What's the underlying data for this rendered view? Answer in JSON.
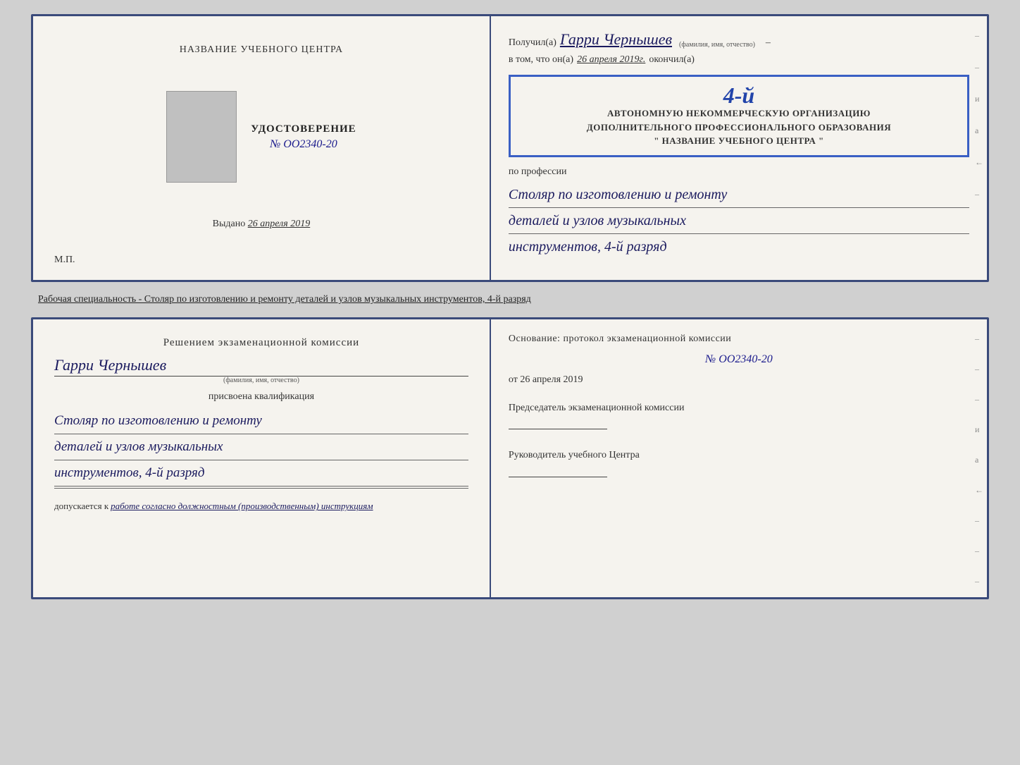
{
  "page": {
    "background": "#d0d0d0"
  },
  "top_cert": {
    "left": {
      "org_name": "НАЗВАНИЕ УЧЕБНОГО ЦЕНТРА",
      "udostoverenie_title": "УДОСТОВЕРЕНИЕ",
      "number_label": "№",
      "number": "OO2340-20",
      "vydano_label": "Выдано",
      "vydano_date": "26 апреля 2019",
      "mp_label": "М.П."
    },
    "right": {
      "poluchil_label": "Получил(а)",
      "name": "Гарри Чернышев",
      "name_hint": "(фамилия, имя, отчество)",
      "vtom_label": "в том, что он(а)",
      "date_value": "26 апреля 2019г.",
      "okonchil_label": "окончил(а)",
      "stamp_line1": "АВТОНОМНУЮ НЕКОММЕРЧЕСКУЮ ОРГАНИЗАЦИЮ",
      "stamp_line2": "ДОПОЛНИТЕЛЬНОГО ПРОФЕССИОНАЛЬНОГО ОБРАЗОВАНИЯ",
      "stamp_line3": "\" НАЗВАНИЕ УЧЕБНОГО ЦЕНТРА \"",
      "stamp_year": "4-й",
      "po_professii_label": "по профессии",
      "profession_line1": "Столяр по изготовлению и ремонту",
      "profession_line2": "деталей и узлов музыкальных",
      "profession_line3": "инструментов, 4-й разряд",
      "side_marks": [
        "–",
        "и",
        "а",
        "←",
        "–"
      ]
    }
  },
  "caption": {
    "text": "Рабочая специальность - Столяр по изготовлению и ремонту деталей и узлов музыкальных инструментов, 4-й разряд"
  },
  "bottom_cert": {
    "left": {
      "resheniem_label": "Решением экзаменационной комиссии",
      "name": "Гарри Чернышев",
      "name_hint": "(фамилия, имя, отчество)",
      "prisvoena_label": "присвоена квалификация",
      "qualification_line1": "Столяр по изготовлению и ремонту",
      "qualification_line2": "деталей и узлов музыкальных",
      "qualification_line3": "инструментов, 4-й разряд",
      "dopuskaetsya_label": "допускается к",
      "dopuskaetsya_value": "работе согласно должностным (производственным) инструкциям"
    },
    "right": {
      "osnovaniye_label": "Основание: протокол экзаменационной комиссии",
      "number_label": "№",
      "number": "OO2340-20",
      "ot_label": "от",
      "ot_date": "26 апреля 2019",
      "predsedatel_title": "Председатель экзаменационной комиссии",
      "rukovoditel_title": "Руководитель учебного Центра",
      "side_marks": [
        "–",
        "–",
        "–",
        "и",
        "а",
        "←",
        "–",
        "–",
        "–"
      ]
    }
  }
}
